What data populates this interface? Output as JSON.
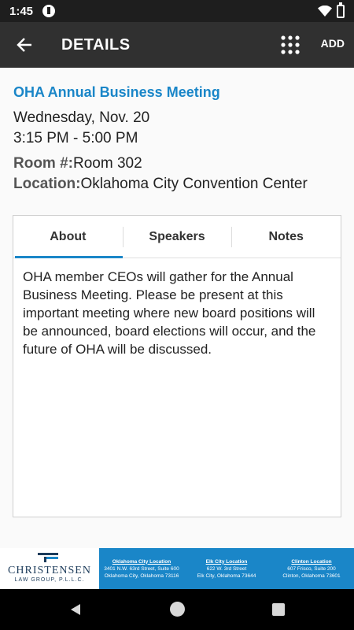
{
  "status_bar": {
    "time": "1:45"
  },
  "app_bar": {
    "title": "DETAILS",
    "add_label": "ADD"
  },
  "event": {
    "title": "OHA Annual Business Meeting",
    "date": "Wednesday, Nov. 20",
    "time": "3:15 PM - 5:00 PM",
    "room_label": "Room #:",
    "room_value": "Room 302",
    "location_label": "Location:",
    "location_value": "Oklahoma City Convention Center"
  },
  "tabs": [
    {
      "label": "About",
      "active": true
    },
    {
      "label": "Speakers",
      "active": false
    },
    {
      "label": "Notes",
      "active": false
    }
  ],
  "about_text": "OHA member CEOs will gather for the Annual Business Meeting. Please be present at this important meeting where new board positions will be announced, board elections will occur, and the future of OHA will be discussed.",
  "banner": {
    "logo_name": "CHRISTENSEN",
    "logo_sub": "LAW GROUP, P.L.L.C.",
    "locations": [
      {
        "title": "Oklahoma City Location",
        "line1": "3401 N.W. 63rd Street, Suite 600",
        "line2": "Oklahoma City, Oklahoma 73116"
      },
      {
        "title": "Elk City Location",
        "line1": "622 W. 3rd Street",
        "line2": "Elk City, Oklahoma 73644"
      },
      {
        "title": "Clinton Location",
        "line1": "607 Frisco, Suite 200",
        "line2": "Clinton, Oklahoma 73601"
      }
    ]
  },
  "colors": {
    "accent": "#1a86c8",
    "app_bar": "#303030",
    "status_bar": "#1e1e1e"
  },
  "icons": {
    "back": "arrow-left-icon",
    "grid": "grid-dots-icon",
    "wifi": "wifi-icon",
    "battery": "battery-icon",
    "notification": "notification-icon"
  }
}
